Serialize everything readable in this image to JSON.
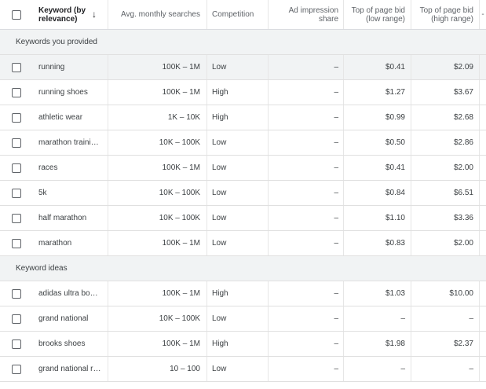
{
  "header": {
    "keyword_line1": "Keyword (by",
    "keyword_line2": "relevance)",
    "sort_icon": "↓",
    "avg_searches": "Avg. monthly searches",
    "competition": "Competition",
    "impression_line1": "Ad impression",
    "impression_line2": "share",
    "low_bid_line1": "Top of page bid",
    "low_bid_line2": "(low range)",
    "high_bid_line1": "Top of page bid",
    "high_bid_line2": "(high range)",
    "edge": "-"
  },
  "groups": [
    {
      "label": "Keywords you provided",
      "rows": [
        {
          "keyword": "running",
          "avg": "100K – 1M",
          "competition": "Low",
          "impression": "–",
          "low": "$0.41",
          "high": "$2.09",
          "highlight": true
        },
        {
          "keyword": "running shoes",
          "avg": "100K – 1M",
          "competition": "High",
          "impression": "–",
          "low": "$1.27",
          "high": "$3.67"
        },
        {
          "keyword": "athletic wear",
          "avg": "1K – 10K",
          "competition": "High",
          "impression": "–",
          "low": "$0.99",
          "high": "$2.68"
        },
        {
          "keyword": "marathon traini…",
          "avg": "10K – 100K",
          "competition": "Low",
          "impression": "–",
          "low": "$0.50",
          "high": "$2.86"
        },
        {
          "keyword": "races",
          "avg": "100K – 1M",
          "competition": "Low",
          "impression": "–",
          "low": "$0.41",
          "high": "$2.00"
        },
        {
          "keyword": "5k",
          "avg": "10K – 100K",
          "competition": "Low",
          "impression": "–",
          "low": "$0.84",
          "high": "$6.51"
        },
        {
          "keyword": "half marathon",
          "avg": "10K – 100K",
          "competition": "Low",
          "impression": "–",
          "low": "$1.10",
          "high": "$3.36"
        },
        {
          "keyword": "marathon",
          "avg": "100K – 1M",
          "competition": "Low",
          "impression": "–",
          "low": "$0.83",
          "high": "$2.00"
        }
      ]
    },
    {
      "label": "Keyword ideas",
      "rows": [
        {
          "keyword": "adidas ultra bo…",
          "avg": "100K – 1M",
          "competition": "High",
          "impression": "–",
          "low": "$1.03",
          "high": "$10.00"
        },
        {
          "keyword": "grand national",
          "avg": "10K – 100K",
          "competition": "Low",
          "impression": "–",
          "low": "–",
          "high": "–"
        },
        {
          "keyword": "brooks shoes",
          "avg": "100K – 1M",
          "competition": "High",
          "impression": "–",
          "low": "$1.98",
          "high": "$2.37"
        },
        {
          "keyword": "grand national r…",
          "avg": "10 – 100",
          "competition": "Low",
          "impression": "–",
          "low": "–",
          "high": "–"
        }
      ]
    }
  ]
}
